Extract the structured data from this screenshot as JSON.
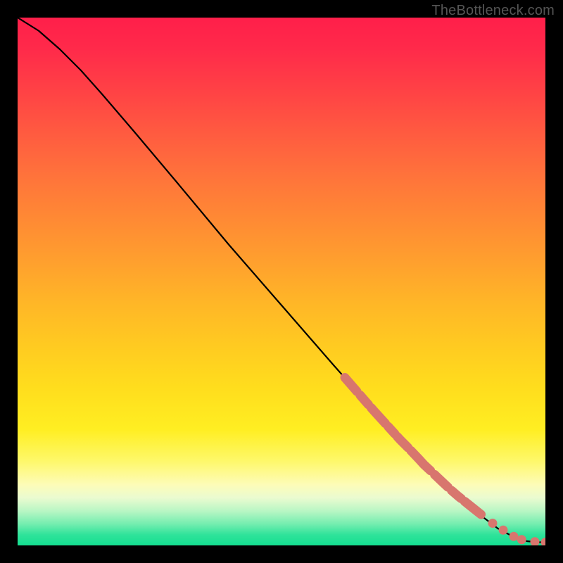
{
  "watermark": "TheBottleneck.com",
  "chart_data": {
    "type": "line",
    "title": "",
    "xlabel": "",
    "ylabel": "",
    "xlim": [
      0,
      100
    ],
    "ylim": [
      0,
      100
    ],
    "series": [
      {
        "name": "curve",
        "x": [
          0,
          4,
          8,
          12,
          16,
          22,
          30,
          40,
          50,
          60,
          68,
          74,
          80,
          84,
          88,
          91,
          94,
          96.5,
          98.5,
          100
        ],
        "y": [
          100,
          97.5,
          94,
          90,
          85.5,
          78.5,
          69,
          57,
          45.5,
          34,
          25,
          18.5,
          12.5,
          9,
          5.5,
          3.2,
          1.6,
          0.8,
          0.6,
          0.6
        ]
      },
      {
        "name": "markers",
        "x": [
          62,
          64,
          66,
          67.5,
          69.5,
          71.5,
          72.5,
          74,
          76,
          77,
          78.5,
          80.5,
          82,
          83.5,
          85,
          86.5,
          88,
          90,
          92,
          94,
          95.5,
          98,
          100
        ],
        "y": [
          31.8,
          29.5,
          27.2,
          25.5,
          23.3,
          21.1,
          20,
          18.5,
          16.4,
          15.3,
          13.9,
          12,
          10.6,
          9.3,
          8.1,
          6.9,
          5.7,
          4.2,
          2.9,
          1.7,
          1.1,
          0.7,
          0.6
        ]
      }
    ],
    "gradient_stops": [
      {
        "pos": 0.0,
        "color": "#ff1f4a"
      },
      {
        "pos": 0.5,
        "color": "#ffb326"
      },
      {
        "pos": 0.8,
        "color": "#fff028"
      },
      {
        "pos": 0.92,
        "color": "#d9f7c6"
      },
      {
        "pos": 1.0,
        "color": "#14de90"
      }
    ],
    "marker_color": "#d8766e",
    "line_color": "#000000"
  }
}
